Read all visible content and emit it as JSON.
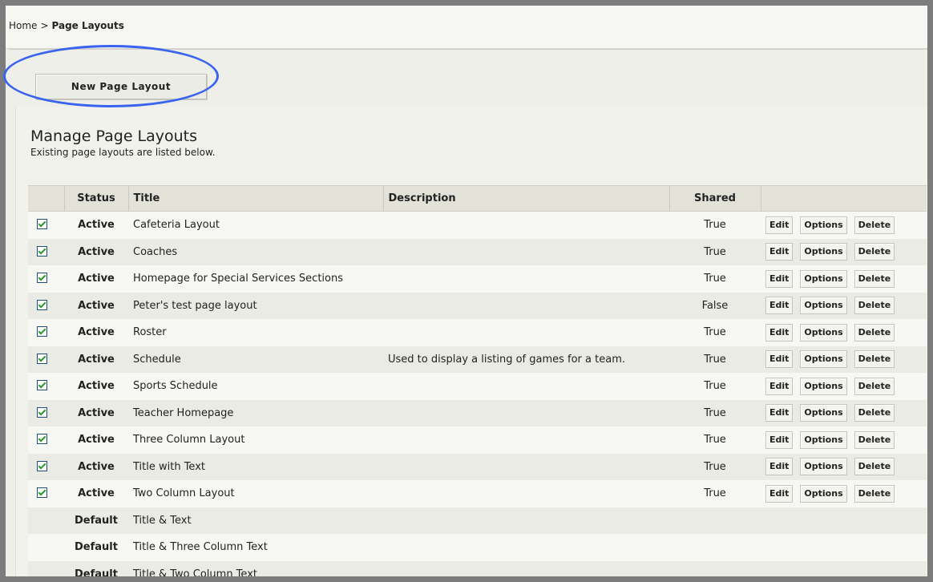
{
  "breadcrumb": {
    "home": "Home",
    "separator": ">",
    "current": "Page Layouts"
  },
  "toolbar": {
    "new_button": "New Page Layout"
  },
  "main": {
    "title": "Manage Page Layouts",
    "subtitle": "Existing page layouts are listed below."
  },
  "table": {
    "headers": {
      "checkbox": "",
      "status": "Status",
      "title": "Title",
      "description": "Description",
      "shared": "Shared",
      "actions": ""
    },
    "action_labels": {
      "edit": "Edit",
      "options": "Options",
      "delete": "Delete"
    },
    "rows": [
      {
        "checked": true,
        "status": "Active",
        "title": "Cafeteria Layout",
        "description": "",
        "shared": "True",
        "actions": true
      },
      {
        "checked": true,
        "status": "Active",
        "title": "Coaches",
        "description": "",
        "shared": "True",
        "actions": true
      },
      {
        "checked": true,
        "status": "Active",
        "title": "Homepage for Special Services Sections",
        "description": "",
        "shared": "True",
        "actions": true
      },
      {
        "checked": true,
        "status": "Active",
        "title": "Peter's test page layout",
        "description": "",
        "shared": "False",
        "actions": true
      },
      {
        "checked": true,
        "status": "Active",
        "title": "Roster",
        "description": "",
        "shared": "True",
        "actions": true
      },
      {
        "checked": true,
        "status": "Active",
        "title": "Schedule",
        "description": "Used to display a listing of games for a team.",
        "shared": "True",
        "actions": true
      },
      {
        "checked": true,
        "status": "Active",
        "title": "Sports Schedule",
        "description": "",
        "shared": "True",
        "actions": true
      },
      {
        "checked": true,
        "status": "Active",
        "title": "Teacher Homepage",
        "description": "",
        "shared": "True",
        "actions": true
      },
      {
        "checked": true,
        "status": "Active",
        "title": "Three Column Layout",
        "description": "",
        "shared": "True",
        "actions": true
      },
      {
        "checked": true,
        "status": "Active",
        "title": "Title with Text",
        "description": "",
        "shared": "True",
        "actions": true
      },
      {
        "checked": true,
        "status": "Active",
        "title": "Two Column Layout",
        "description": "",
        "shared": "True",
        "actions": true
      },
      {
        "checked": false,
        "status": "Default",
        "title": "Title & Text",
        "description": "",
        "shared": "",
        "actions": false
      },
      {
        "checked": false,
        "status": "Default",
        "title": "Title & Three Column Text",
        "description": "",
        "shared": "",
        "actions": false
      },
      {
        "checked": false,
        "status": "Default",
        "title": "Title & Two Column Text",
        "description": "",
        "shared": "",
        "actions": false
      }
    ]
  },
  "colors": {
    "highlight_ellipse": "#3a64f0",
    "checkbox_check": "#2b9a2b"
  }
}
